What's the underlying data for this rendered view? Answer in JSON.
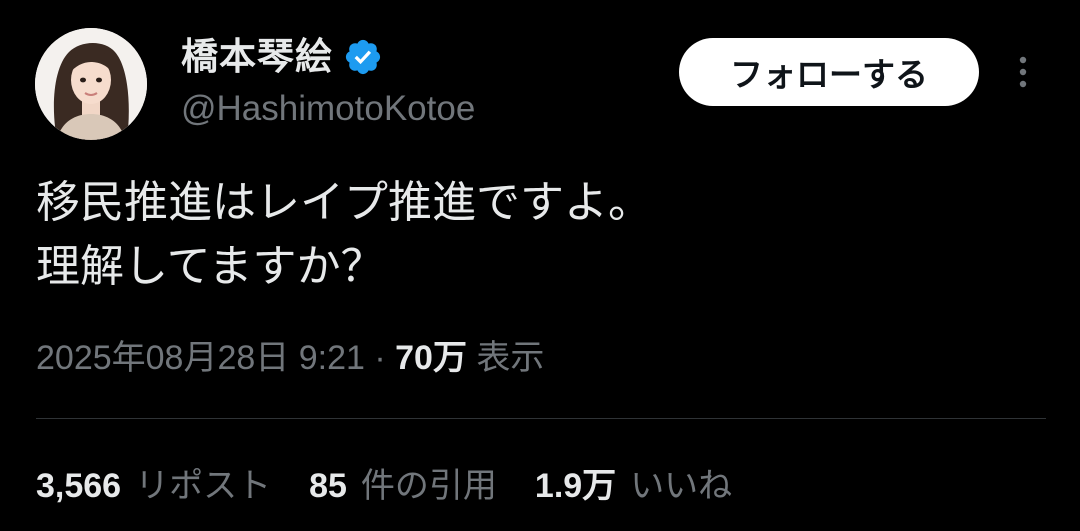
{
  "author": {
    "display_name": "橋本琴絵",
    "handle": "@HashimotoKotoe",
    "verified_icon": "verified-badge-icon",
    "avatar_icon": "profile-avatar"
  },
  "follow_button": {
    "label": "フォローする"
  },
  "more_icon": "more-options-icon",
  "tweet": {
    "text_lines": [
      "移民推進はレイプ推進ですよ。",
      "理解してますか？"
    ]
  },
  "meta": {
    "timestamp": "2025年08月28日 9:21",
    "separator": "·",
    "views_count": "70万",
    "views_label": "表示"
  },
  "stats": {
    "reposts_count": "3,566",
    "reposts_label": "リポスト",
    "quotes_count": "85",
    "quotes_label": "件の引用",
    "likes_count": "1.9万",
    "likes_label": "いいね"
  },
  "colors": {
    "background": "#000000",
    "primary_text": "#e7e9ea",
    "secondary_text": "#71767b",
    "verified_blue": "#1d9bf0",
    "divider": "#2f3336",
    "follow_bg": "#ffffff"
  }
}
